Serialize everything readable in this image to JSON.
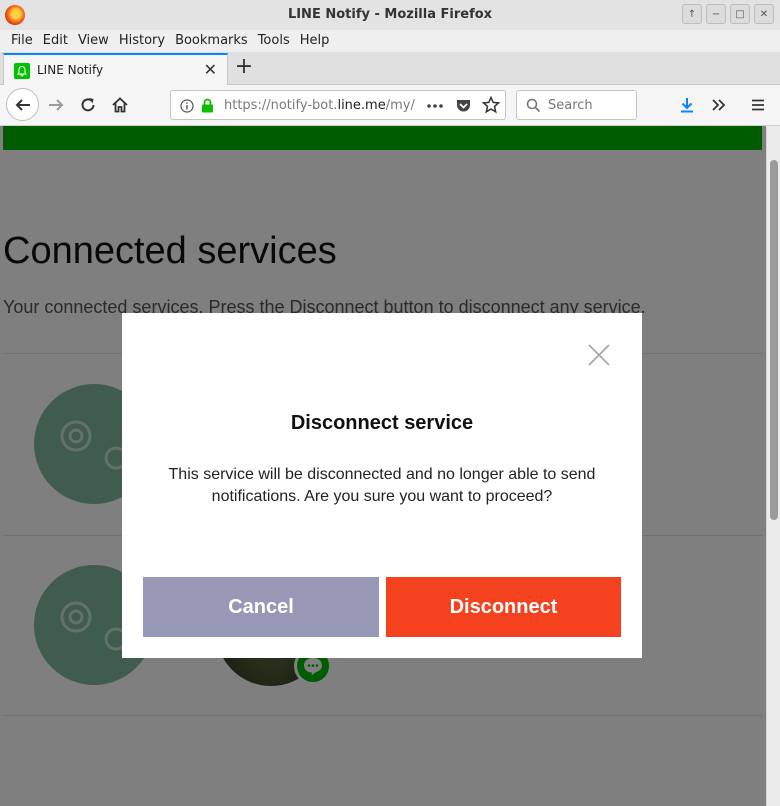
{
  "window": {
    "title": "LINE Notify - Mozilla Firefox",
    "buttons": [
      "↑",
      "−",
      "□",
      "✕"
    ]
  },
  "menu": [
    "File",
    "Edit",
    "View",
    "History",
    "Bookmarks",
    "Tools",
    "Help"
  ],
  "tab": {
    "title": "LINE Notify",
    "close": "✕",
    "new_tab": "+"
  },
  "navbar": {
    "url_prefix": "https://notify-bot.",
    "url_domain": "line.me",
    "url_path": "/my/",
    "search_placeholder": "Search"
  },
  "page": {
    "title": "Connected services",
    "subtitle": "Your connected services. Press the Disconnect button to disconnect any service."
  },
  "modal": {
    "title": "Disconnect service",
    "body": "This service will be disconnected and no longer able to send notifications. Are you sure you want to proceed?",
    "cancel_label": "Cancel",
    "disconnect_label": "Disconnect"
  },
  "colors": {
    "brand_green": "#00b900",
    "cancel": "#9698b5",
    "disconnect": "#f4421e"
  }
}
